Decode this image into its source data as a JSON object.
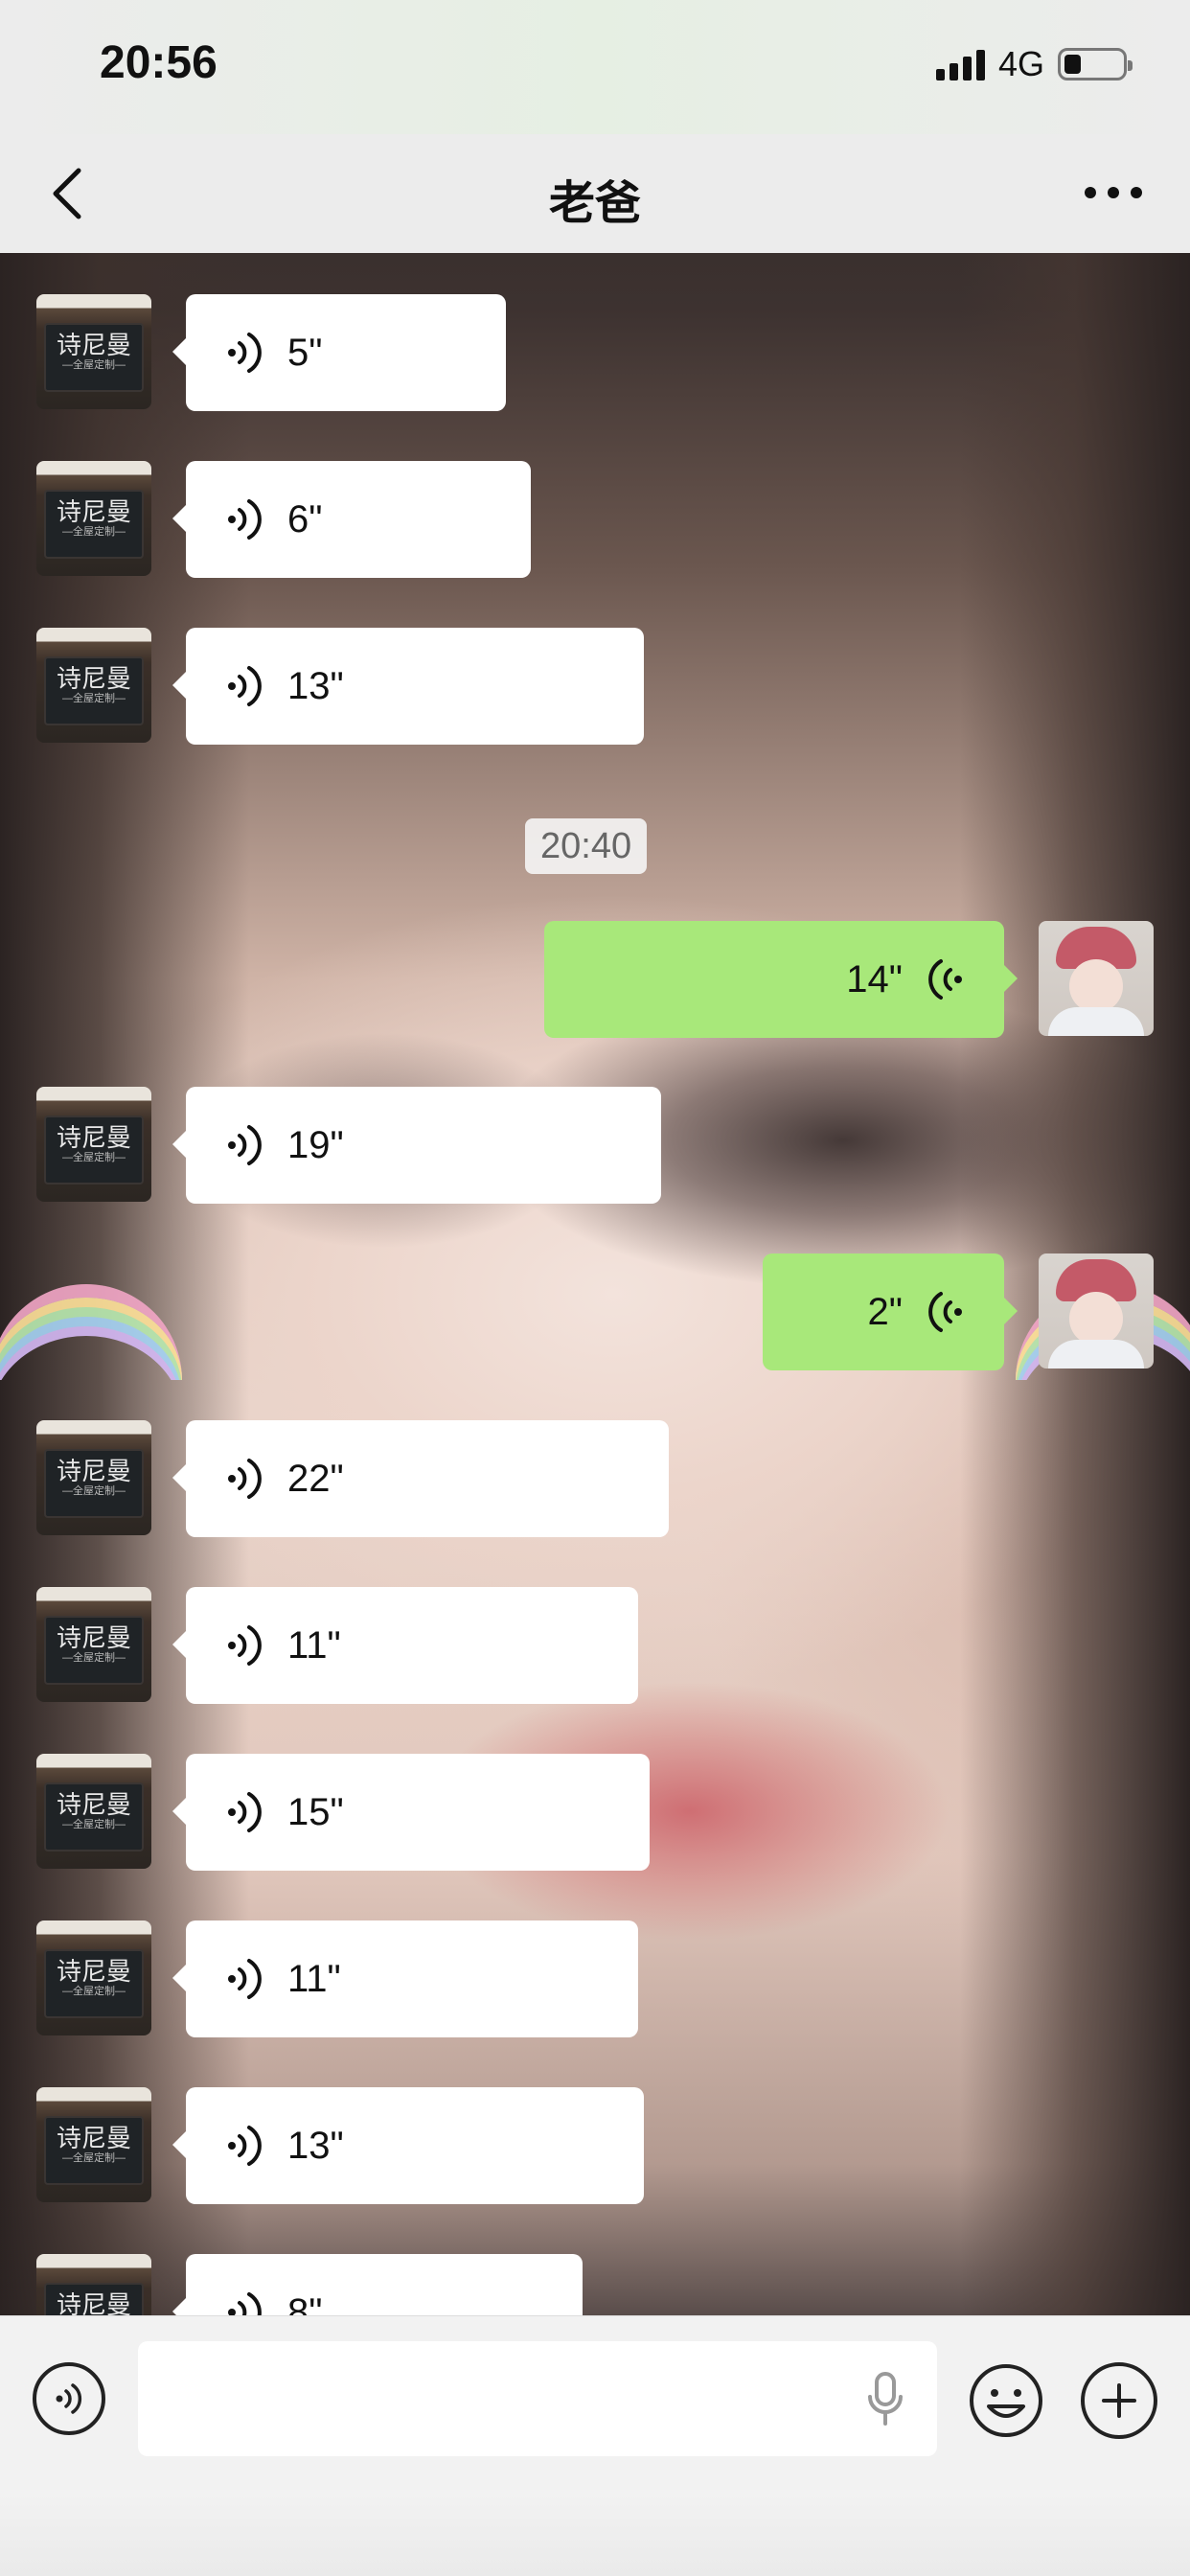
{
  "status_bar": {
    "time": "20:56",
    "network": "4G",
    "battery_level": 0.3
  },
  "nav": {
    "title": "老爸",
    "back_icon": "chevron-left-icon",
    "more_icon": "more-dots-icon"
  },
  "avatar_text": {
    "brand": "诗尼曼",
    "tagline": "—全屋定制—"
  },
  "messages": [
    {
      "side": "in",
      "duration": "5\""
    },
    {
      "side": "in",
      "duration": "6\""
    },
    {
      "side": "in",
      "duration": "13\""
    },
    {
      "type": "time",
      "text": "20:40"
    },
    {
      "side": "out",
      "duration": "14\""
    },
    {
      "side": "in",
      "duration": "19\""
    },
    {
      "side": "out",
      "duration": "2\""
    },
    {
      "side": "in",
      "duration": "22\""
    },
    {
      "side": "in",
      "duration": "11\""
    },
    {
      "side": "in",
      "duration": "15\""
    },
    {
      "side": "in",
      "duration": "11\""
    },
    {
      "side": "in",
      "duration": "13\""
    },
    {
      "side": "in",
      "duration": "8\""
    }
  ],
  "input_bar": {
    "placeholder": "",
    "icons": [
      "voice-toggle-icon",
      "microphone-icon",
      "emoji-icon",
      "plus-icon"
    ]
  },
  "colors": {
    "outgoing_bubble": "#a8e87a",
    "incoming_bubble": "#ffffff"
  }
}
